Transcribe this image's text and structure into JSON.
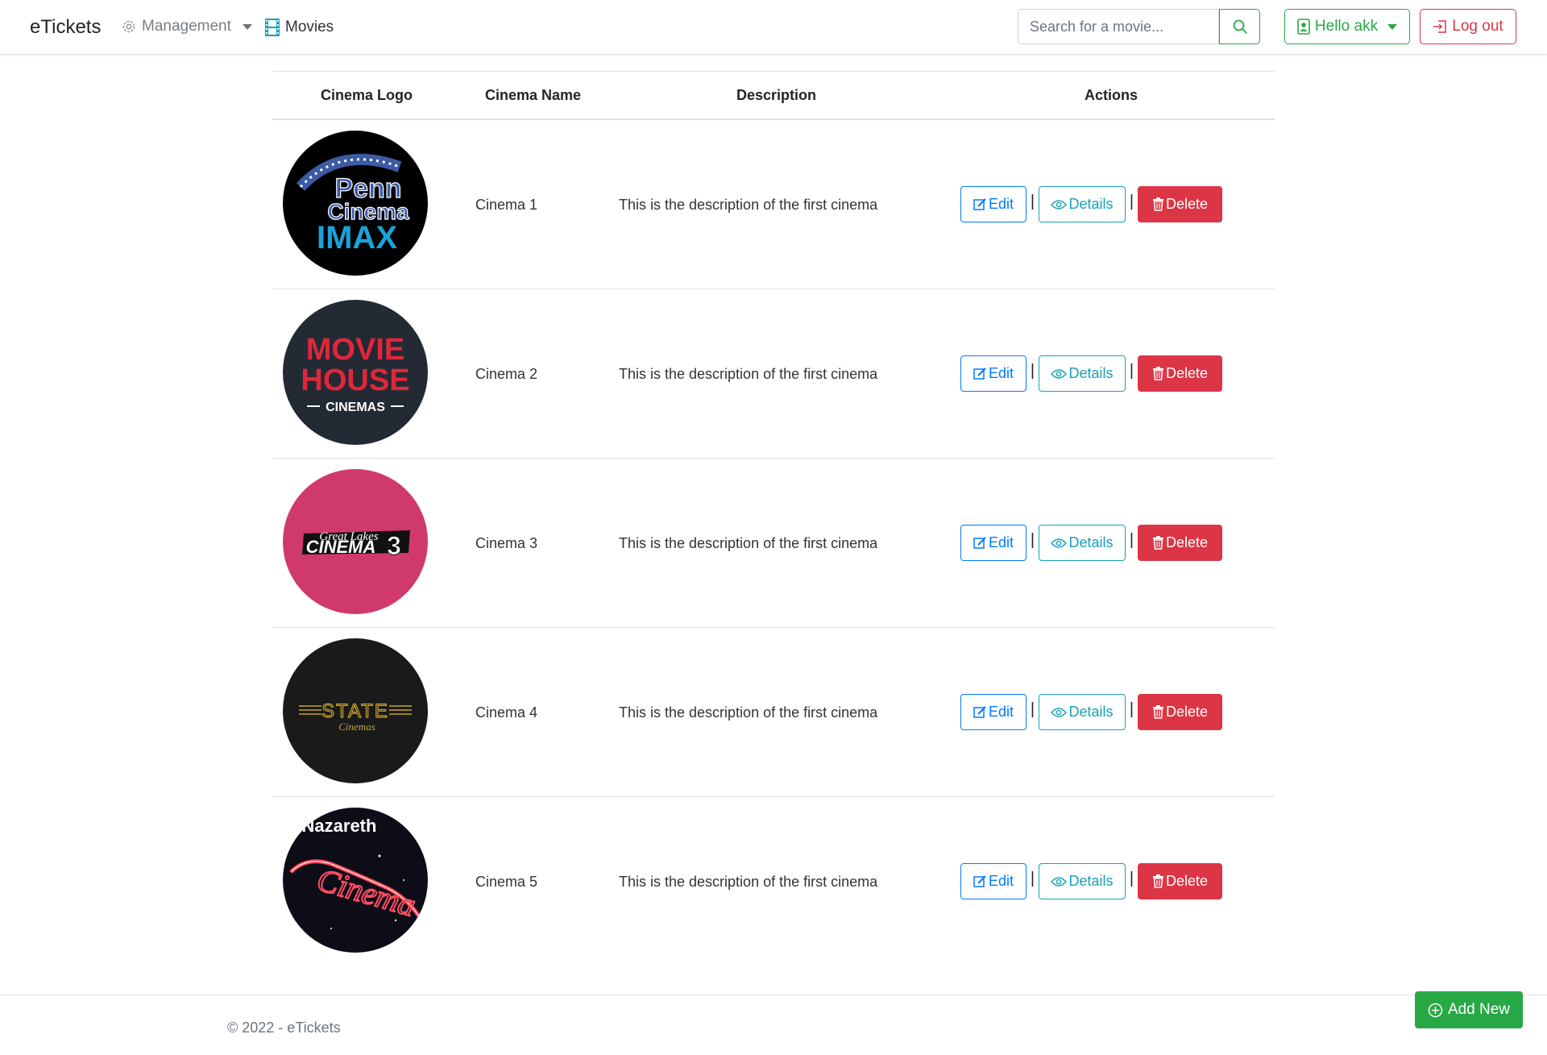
{
  "navbar": {
    "brand": "eTickets",
    "management_label": "Management",
    "movies_label": "Movies",
    "search_placeholder": "Search for a movie...",
    "user_label": "Hello akk",
    "logout_label": "Log out"
  },
  "table": {
    "headers": [
      "Cinema Logo",
      "Cinema Name",
      "Description",
      "Actions"
    ],
    "rows": [
      {
        "name": "Cinema 1",
        "description": "This is the description of the first cinema",
        "logo": "penn-cinema-imax-logo"
      },
      {
        "name": "Cinema 2",
        "description": "This is the description of the first cinema",
        "logo": "movie-house-cinemas-logo"
      },
      {
        "name": "Cinema 3",
        "description": "This is the description of the first cinema",
        "logo": "great-lakes-cinema-3-logo"
      },
      {
        "name": "Cinema 4",
        "description": "This is the description of the first cinema",
        "logo": "state-cinemas-logo"
      },
      {
        "name": "Cinema 5",
        "description": "This is the description of the first cinema",
        "logo": "nazareth-cinema-logo"
      }
    ],
    "actions": {
      "edit": "Edit",
      "details": "Details",
      "delete": "Delete",
      "separator": "|"
    }
  },
  "logos": {
    "penn": {
      "line1": "Penn",
      "line2": "Cinema",
      "line3": "IMAX"
    },
    "moviehouse": {
      "line1": "MOVIE",
      "line2": "HOUSE",
      "line3": "CINEMAS"
    },
    "greatlakes": {
      "line1": "Great Lakes",
      "line2": "CINEMA",
      "line3": "3"
    },
    "state": {
      "line1": "STATE",
      "line2": "Cinemas"
    },
    "nazareth": {
      "line1": "Nazareth",
      "line2": "Cinema"
    }
  },
  "footer": {
    "copyright": "© 2022 - eTickets",
    "add_new": "Add New"
  },
  "colors": {
    "success": "#28a745",
    "danger": "#dc3545",
    "primary": "#007bff",
    "info": "#17a2b8"
  }
}
